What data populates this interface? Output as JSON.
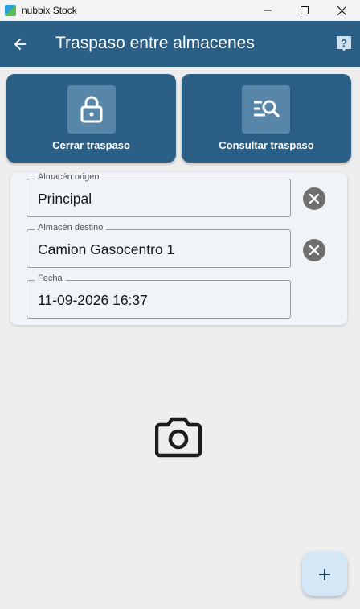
{
  "window": {
    "title": "nubbix Stock"
  },
  "appbar": {
    "title": "Traspaso entre almacenes"
  },
  "actions": [
    {
      "label": "Cerrar traspaso",
      "icon": "lock-icon"
    },
    {
      "label": "Consultar traspaso",
      "icon": "list-search-icon"
    }
  ],
  "form": {
    "origin": {
      "label": "Almacén origen",
      "value": "Principal"
    },
    "destination": {
      "label": "Almacén destino",
      "value": "Camion Gasocentro 1"
    },
    "date": {
      "label": "Fecha",
      "value": "11-09-2026 16:37"
    }
  },
  "icons": {
    "camera": "camera-icon",
    "fab": "add-icon"
  },
  "colors": {
    "appbar": "#2b5f86",
    "background": "#eeeeee",
    "fab": "#d4e7f7"
  }
}
